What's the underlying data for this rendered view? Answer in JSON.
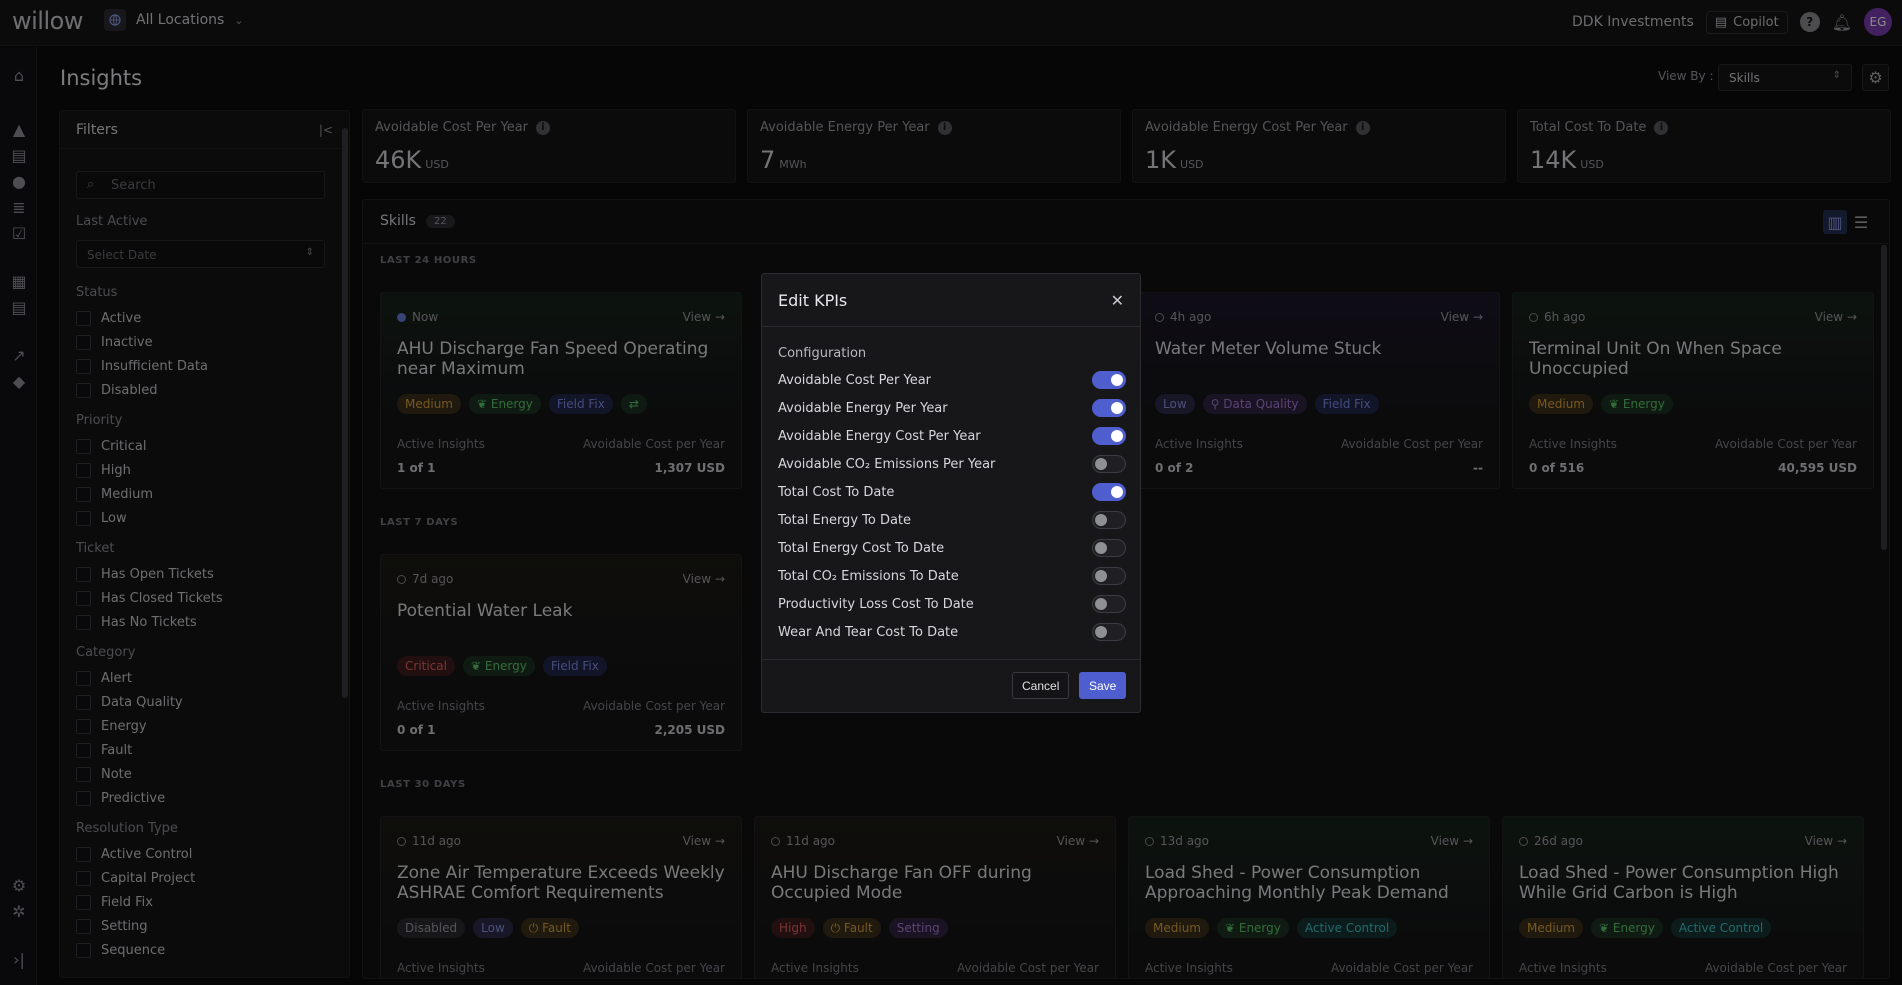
{
  "app": {
    "logo": "willow",
    "location": "All Locations",
    "org": "DDK Investments",
    "copilot": "Copilot",
    "avatar": "EG"
  },
  "page": {
    "title": "Insights",
    "view_by_label": "View By :",
    "view_by_value": "Skills"
  },
  "filters": {
    "title": "Filters",
    "search_placeholder": "Search",
    "last_active_label": "Last Active",
    "date_placeholder": "Select Date",
    "groups": [
      {
        "label": "Status",
        "items": [
          "Active",
          "Inactive",
          "Insufficient Data",
          "Disabled"
        ]
      },
      {
        "label": "Priority",
        "items": [
          "Critical",
          "High",
          "Medium",
          "Low"
        ]
      },
      {
        "label": "Ticket",
        "items": [
          "Has Open Tickets",
          "Has Closed Tickets",
          "Has No Tickets"
        ]
      },
      {
        "label": "Category",
        "items": [
          "Alert",
          "Data Quality",
          "Energy",
          "Fault",
          "Note",
          "Predictive"
        ]
      },
      {
        "label": "Resolution Type",
        "items": [
          "Active Control",
          "Capital Project",
          "Field Fix",
          "Setting",
          "Sequence"
        ]
      }
    ]
  },
  "kpis": [
    {
      "label": "Avoidable Cost Per Year",
      "value": "46K",
      "unit": "USD"
    },
    {
      "label": "Avoidable Energy Per Year",
      "value": "7",
      "unit": "MWh"
    },
    {
      "label": "Avoidable Energy Cost Per Year",
      "value": "1K",
      "unit": "USD"
    },
    {
      "label": "Total Cost To Date",
      "value": "14K",
      "unit": "USD"
    }
  ],
  "skills": {
    "title": "Skills",
    "count": "22",
    "sections": [
      "LAST 24 HOURS",
      "LAST 7 DAYS",
      "LAST 30 DAYS"
    ],
    "active_label": "Active Insights",
    "cost_label": "Avoidable Cost per Year",
    "view_label": "View",
    "cards": [
      {
        "time": "Now",
        "title": "AHU Discharge Fan Speed Operating near Maximum",
        "tags": [
          "Medium",
          "Energy",
          "Field Fix",
          "⇄"
        ],
        "active": "1 of 1",
        "cost": "1,307 USD"
      },
      {
        "time": "4h ago",
        "title": "Water Meter Volume Stuck",
        "tags": [
          "Low",
          "Data Quality",
          "Field Fix"
        ],
        "active": "0 of 2",
        "cost": "--"
      },
      {
        "time": "6h ago",
        "title": "Terminal Unit On When Space Unoccupied",
        "tags": [
          "Medium",
          "Energy"
        ],
        "active": "0 of 516",
        "cost": "40,595 USD"
      },
      {
        "time": "7d ago",
        "title": "Potential Water Leak",
        "tags": [
          "Critical",
          "Energy",
          "Field Fix"
        ],
        "active": "0 of 1",
        "cost": "2,205 USD"
      },
      {
        "time": "11d ago",
        "title": "Zone Air Temperature Exceeds Weekly ASHRAE Comfort Requirements",
        "tags": [
          "Disabled",
          "Low",
          "Fault"
        ],
        "active": "",
        "cost": ""
      },
      {
        "time": "11d ago",
        "title": "AHU Discharge Fan OFF during Occupied Mode",
        "tags": [
          "High",
          "Fault",
          "Setting"
        ],
        "active": "",
        "cost": ""
      },
      {
        "time": "13d ago",
        "title": "Load Shed - Power Consumption Approaching Monthly Peak Demand",
        "tags": [
          "Medium",
          "Energy",
          "Active Control"
        ],
        "active": "",
        "cost": ""
      },
      {
        "time": "26d ago",
        "title": "Load Shed - Power Consumption High While Grid Carbon is High",
        "tags": [
          "Medium",
          "Energy",
          "Active Control"
        ],
        "active": "",
        "cost": ""
      }
    ]
  },
  "modal": {
    "title": "Edit KPIs",
    "section": "Configuration",
    "rows": [
      {
        "label": "Avoidable Cost Per Year",
        "on": true
      },
      {
        "label": "Avoidable Energy Per Year",
        "on": true
      },
      {
        "label": "Avoidable Energy Cost Per Year",
        "on": true
      },
      {
        "label": "Avoidable CO₂ Emissions Per Year",
        "on": false
      },
      {
        "label": "Total Cost To Date",
        "on": true
      },
      {
        "label": "Total Energy To Date",
        "on": false
      },
      {
        "label": "Total Energy Cost To Date",
        "on": false
      },
      {
        "label": "Total CO₂ Emissions To Date",
        "on": false
      },
      {
        "label": "Productivity Loss Cost To Date",
        "on": false
      },
      {
        "label": "Wear And Tear Cost To Date",
        "on": false
      }
    ],
    "cancel": "Cancel",
    "save": "Save"
  }
}
